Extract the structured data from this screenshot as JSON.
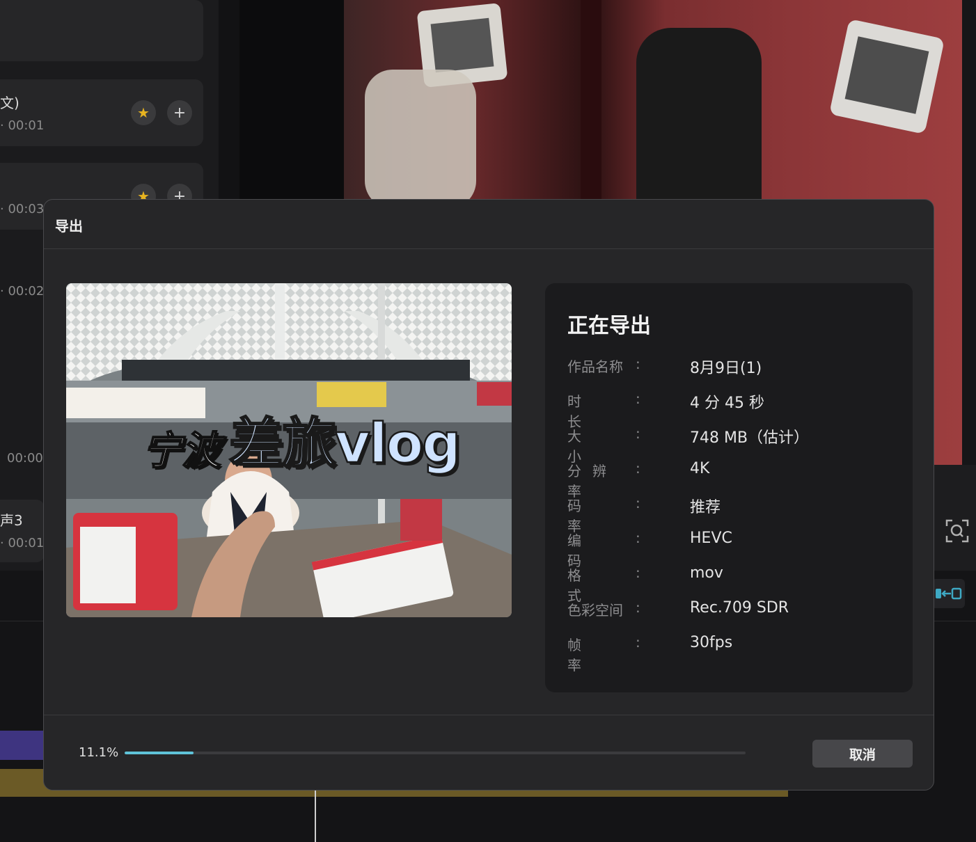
{
  "background": {
    "filter_icon": "filter-sort-icon",
    "media_items": [
      {
        "title": "文)",
        "duration": "00:01",
        "star": "star-icon",
        "add": "plus-icon"
      },
      {
        "title": "",
        "duration": "00:03",
        "star": "star-icon",
        "add": "plus-icon"
      },
      {
        "title": "",
        "duration": "00:02"
      },
      {
        "title": "",
        "duration": "00:00"
      },
      {
        "title": "声3",
        "duration": "00:01"
      }
    ]
  },
  "modal": {
    "title": "导出",
    "preview": {
      "caption_a": "宁波",
      "caption_b": "差旅vlog"
    },
    "info": {
      "heading": "正在导出",
      "rows": [
        {
          "label": "作品名称",
          "value": "8月9日(1)"
        },
        {
          "label": "时长",
          "value": "4 分 45 秒"
        },
        {
          "label": "大小",
          "value": "748 MB（估计）"
        },
        {
          "label": "分辨率",
          "value": "4K"
        },
        {
          "label": "码率",
          "value": "推荐"
        },
        {
          "label": "编码",
          "value": "HEVC"
        },
        {
          "label": "格式",
          "value": "mov"
        },
        {
          "label": "色彩空间",
          "value": "Rec.709 SDR"
        },
        {
          "label": "帧率",
          "value": "30fps"
        }
      ]
    },
    "progress": {
      "text": "11.1%",
      "fraction": 0.111
    },
    "cancel_label": "取消"
  },
  "colors": {
    "accent": "#5fc3d9",
    "panel": "#1b1b1d",
    "modal": "#262628"
  }
}
